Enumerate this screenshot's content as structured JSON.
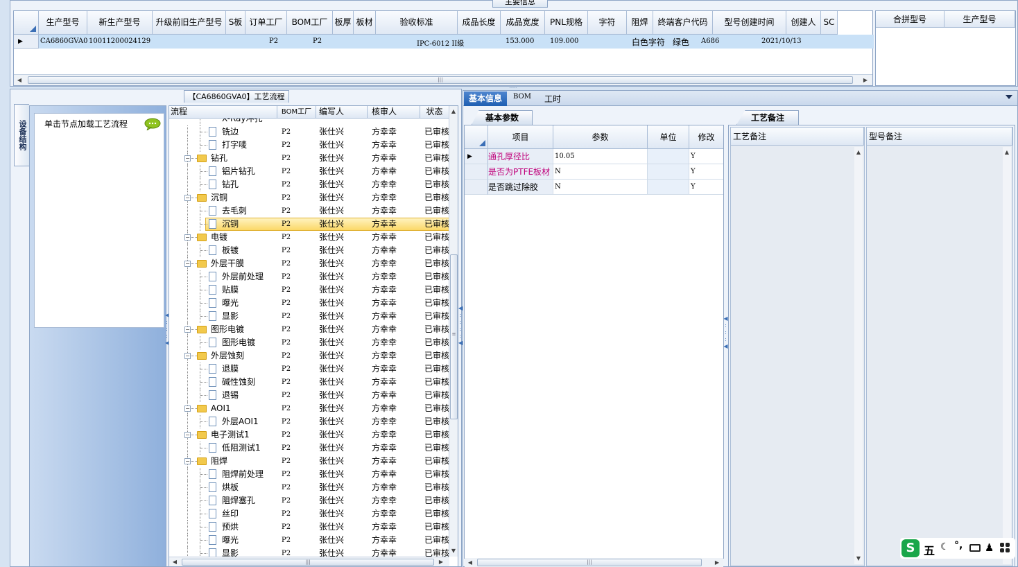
{
  "top": {
    "title": "主要信息",
    "columns": [
      "生产型号",
      "新生产型号",
      "升级前旧生产型号",
      "S板",
      "订单工厂",
      "BOM工厂",
      "板厚",
      "板材",
      "验收标准",
      "成品长度",
      "成品宽度",
      "PNL规格",
      "字符",
      "阻焊",
      "终端客户代码",
      "型号创建时间",
      "创建人",
      "SC"
    ],
    "row": {
      "prod_no": "CA6860GVA0",
      "new_prod_no": "10011200024129",
      "order_factory": "P2",
      "bom_factory": "P2",
      "standard": "IPC-6012 II级",
      "length": "153.000",
      "width": "109.000",
      "char": "白色字符",
      "solder": "绿色",
      "customer": "A686",
      "created": "2021/10/13"
    },
    "side_columns": [
      "合拼型号",
      "生产型号"
    ]
  },
  "left": {
    "vtab": "设备结构",
    "hint": "单击节点加载工艺流程"
  },
  "flow": {
    "title": "【CA6860GVA0】工艺流程",
    "headers": [
      "流程",
      "BOM工厂",
      "编写人",
      "核审人",
      "状态"
    ],
    "partial_top": "X-Ray冲孔",
    "rows": [
      {
        "name": "铣边",
        "level": 2,
        "bom": "P2",
        "writer": "张仕兴",
        "reviewer": "方幸幸",
        "status": "已审核"
      },
      {
        "name": "打字唛",
        "level": 2,
        "bom": "P2",
        "writer": "张仕兴",
        "reviewer": "方幸幸",
        "status": "已审核"
      },
      {
        "name": "钻孔",
        "level": 1,
        "bom": "P2",
        "writer": "张仕兴",
        "reviewer": "方幸幸",
        "status": "已审核"
      },
      {
        "name": "铝片钻孔",
        "level": 2,
        "bom": "P2",
        "writer": "张仕兴",
        "reviewer": "方幸幸",
        "status": "已审核"
      },
      {
        "name": "钻孔",
        "level": 2,
        "bom": "P2",
        "writer": "张仕兴",
        "reviewer": "方幸幸",
        "status": "已审核"
      },
      {
        "name": "沉铜",
        "level": 1,
        "bom": "P2",
        "writer": "张仕兴",
        "reviewer": "方幸幸",
        "status": "已审核"
      },
      {
        "name": "去毛刺",
        "level": 2,
        "bom": "P2",
        "writer": "张仕兴",
        "reviewer": "方幸幸",
        "status": "已审核"
      },
      {
        "name": "沉铜",
        "level": 2,
        "bom": "P2",
        "writer": "张仕兴",
        "reviewer": "方幸幸",
        "status": "已审核",
        "selected": true
      },
      {
        "name": "电镀",
        "level": 1,
        "bom": "P2",
        "writer": "张仕兴",
        "reviewer": "方幸幸",
        "status": "已审核"
      },
      {
        "name": "板镀",
        "level": 2,
        "bom": "P2",
        "writer": "张仕兴",
        "reviewer": "方幸幸",
        "status": "已审核"
      },
      {
        "name": "外层干膜",
        "level": 1,
        "bom": "P2",
        "writer": "张仕兴",
        "reviewer": "方幸幸",
        "status": "已审核"
      },
      {
        "name": "外层前处理",
        "level": 2,
        "bom": "P2",
        "writer": "张仕兴",
        "reviewer": "方幸幸",
        "status": "已审核"
      },
      {
        "name": "贴膜",
        "level": 2,
        "bom": "P2",
        "writer": "张仕兴",
        "reviewer": "方幸幸",
        "status": "已审核"
      },
      {
        "name": "曝光",
        "level": 2,
        "bom": "P2",
        "writer": "张仕兴",
        "reviewer": "方幸幸",
        "status": "已审核"
      },
      {
        "name": "显影",
        "level": 2,
        "bom": "P2",
        "writer": "张仕兴",
        "reviewer": "方幸幸",
        "status": "已审核"
      },
      {
        "name": "图形电镀",
        "level": 1,
        "bom": "P2",
        "writer": "张仕兴",
        "reviewer": "方幸幸",
        "status": "已审核"
      },
      {
        "name": "图形电镀",
        "level": 2,
        "bom": "P2",
        "writer": "张仕兴",
        "reviewer": "方幸幸",
        "status": "已审核"
      },
      {
        "name": "外层蚀刻",
        "level": 1,
        "bom": "P2",
        "writer": "张仕兴",
        "reviewer": "方幸幸",
        "status": "已审核"
      },
      {
        "name": "退膜",
        "level": 2,
        "bom": "P2",
        "writer": "张仕兴",
        "reviewer": "方幸幸",
        "status": "已审核"
      },
      {
        "name": "碱性蚀刻",
        "level": 2,
        "bom": "P2",
        "writer": "张仕兴",
        "reviewer": "方幸幸",
        "status": "已审核"
      },
      {
        "name": "退锡",
        "level": 2,
        "bom": "P2",
        "writer": "张仕兴",
        "reviewer": "方幸幸",
        "status": "已审核"
      },
      {
        "name": "AOI1",
        "level": 1,
        "bom": "P2",
        "writer": "张仕兴",
        "reviewer": "方幸幸",
        "status": "已审核"
      },
      {
        "name": "外层AOI1",
        "level": 2,
        "bom": "P2",
        "writer": "张仕兴",
        "reviewer": "方幸幸",
        "status": "已审核"
      },
      {
        "name": "电子测试1",
        "level": 1,
        "bom": "P2",
        "writer": "张仕兴",
        "reviewer": "方幸幸",
        "status": "已审核"
      },
      {
        "name": "低阻测试1",
        "level": 2,
        "bom": "P2",
        "writer": "张仕兴",
        "reviewer": "方幸幸",
        "status": "已审核"
      },
      {
        "name": "阻焊",
        "level": 1,
        "bom": "P2",
        "writer": "张仕兴",
        "reviewer": "方幸幸",
        "status": "已审核"
      },
      {
        "name": "阻焊前处理",
        "level": 2,
        "bom": "P2",
        "writer": "张仕兴",
        "reviewer": "方幸幸",
        "status": "已审核"
      },
      {
        "name": "烘板",
        "level": 2,
        "bom": "P2",
        "writer": "张仕兴",
        "reviewer": "方幸幸",
        "status": "已审核"
      },
      {
        "name": "阻焊塞孔",
        "level": 2,
        "bom": "P2",
        "writer": "张仕兴",
        "reviewer": "方幸幸",
        "status": "已审核"
      },
      {
        "name": "丝印",
        "level": 2,
        "bom": "P2",
        "writer": "张仕兴",
        "reviewer": "方幸幸",
        "status": "已审核"
      },
      {
        "name": "预烘",
        "level": 2,
        "bom": "P2",
        "writer": "张仕兴",
        "reviewer": "方幸幸",
        "status": "已审核"
      },
      {
        "name": "曝光",
        "level": 2,
        "bom": "P2",
        "writer": "张仕兴",
        "reviewer": "方幸幸",
        "status": "已审核"
      },
      {
        "name": "显影",
        "level": 2,
        "bom": "P2",
        "writer": "张仕兴",
        "reviewer": "方幸幸",
        "status": "已审核"
      }
    ]
  },
  "right": {
    "tabs": [
      "基本信息",
      "BOM",
      "工时"
    ],
    "subtab": "基本参数",
    "param_headers": [
      "项目",
      "参数",
      "单位",
      "修改"
    ],
    "params": [
      {
        "item": "通孔厚径比",
        "value": "10.05",
        "unit": "",
        "edit": "Y",
        "color": "#c0007a"
      },
      {
        "item": "是否为PTFE板材",
        "value": "N",
        "unit": "",
        "edit": "Y",
        "color": "#c0007a"
      },
      {
        "item": "是否跳过除胶",
        "value": "N",
        "unit": "",
        "edit": "Y",
        "color": "#000000"
      }
    ],
    "notes_tab": "工艺备注",
    "notes_headers": [
      "工艺备注",
      "型号备注"
    ]
  },
  "ime": {
    "logo": "S",
    "mode": "五",
    "icons": [
      "moon-icon",
      "punct-icon",
      "keyboard-icon",
      "user-icon",
      "grid-icon"
    ]
  }
}
